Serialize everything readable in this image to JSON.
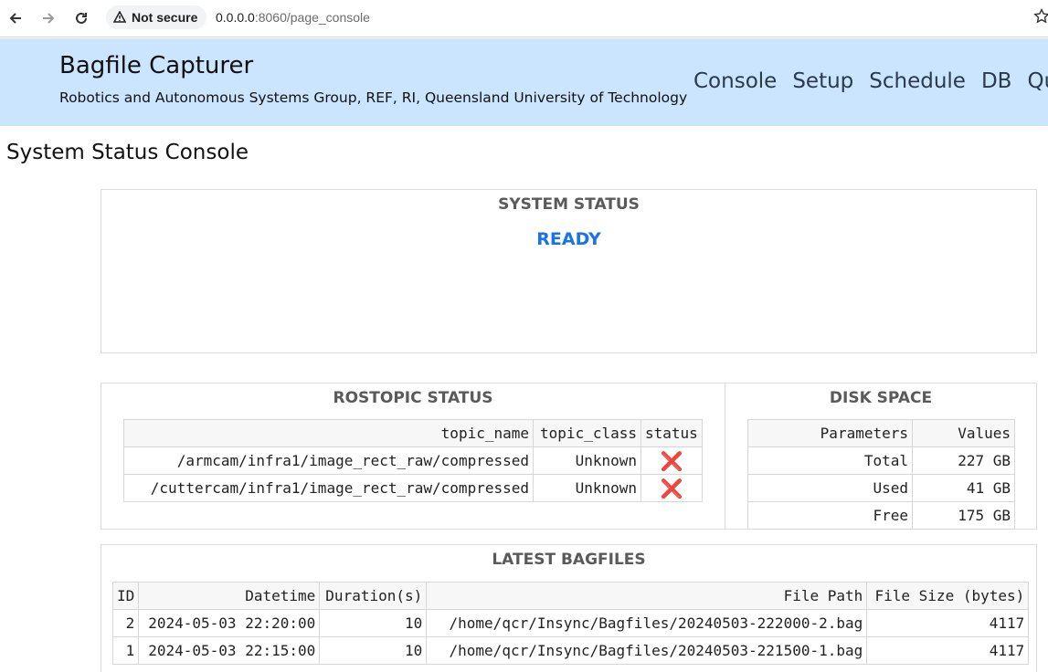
{
  "browser": {
    "security_label": "Not secure",
    "url_host": "0.0.0.0",
    "url_rest": ":8060/page_console"
  },
  "header": {
    "brand": "Bagfile Capturer",
    "subtitle": "Robotics and Autonomous Systems Group, REF, RI, Queensland University of Technology",
    "nav": [
      "Console",
      "Setup",
      "Schedule",
      "DB",
      "Que"
    ]
  },
  "page_title": "System Status Console",
  "system_status": {
    "title": "SYSTEM STATUS",
    "value": "READY"
  },
  "rostopic": {
    "title": "ROSTOPIC STATUS",
    "columns": [
      "topic_name",
      "topic_class",
      "status"
    ],
    "rows": [
      {
        "topic_name": "/armcam/infra1/image_rect_raw/compressed",
        "topic_class": "Unknown",
        "status": "❌"
      },
      {
        "topic_name": "/cuttercam/infra1/image_rect_raw/compressed",
        "topic_class": "Unknown",
        "status": "❌"
      }
    ]
  },
  "disk": {
    "title": "DISK SPACE",
    "columns": [
      "Parameters",
      "Values"
    ],
    "rows": [
      {
        "param": "Total",
        "value": "227 GB"
      },
      {
        "param": "Used",
        "value": "41 GB"
      },
      {
        "param": "Free",
        "value": "175 GB"
      }
    ]
  },
  "bagfiles": {
    "title": "LATEST BAGFILES",
    "columns": [
      "ID",
      "Datetime",
      "Duration(s)",
      "File Path",
      "File Size (bytes)"
    ],
    "rows": [
      {
        "id": "2",
        "datetime": "2024-05-03 22:20:00",
        "duration": "10",
        "path": "/home/qcr/Insync/Bagfiles/20240503-222000-2.bag",
        "size": "4117"
      },
      {
        "id": "1",
        "datetime": "2024-05-03 22:15:00",
        "duration": "10",
        "path": "/home/qcr/Insync/Bagfiles/20240503-221500-1.bag",
        "size": "4117"
      }
    ]
  },
  "colors": {
    "banner_bg": "#cce5ff",
    "ready_text": "#1a73e8",
    "status_error": "#e02424"
  }
}
